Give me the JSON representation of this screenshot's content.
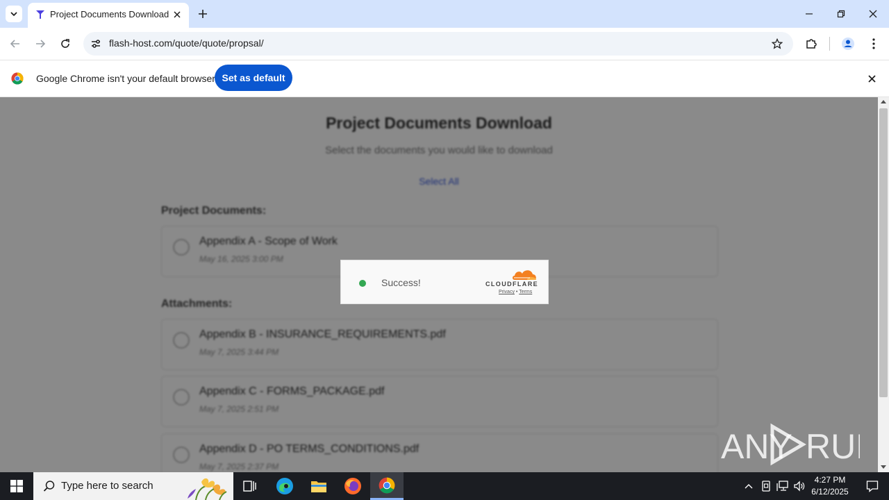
{
  "browser": {
    "tab": {
      "title": "Project Documents Download"
    },
    "url": "flash-host.com/quote/quote/propsal/",
    "infobar": {
      "message": "Google Chrome isn't your default browser",
      "button_label": "Set as default"
    }
  },
  "page": {
    "title": "Project Documents Download",
    "subtitle": "Select the documents you would like to download",
    "select_all": "Select All",
    "sections": {
      "project_documents": {
        "label": "Project Documents:",
        "items": [
          {
            "name": "Appendix A - Scope of Work",
            "date": "May 16, 2025 3:00 PM"
          }
        ]
      },
      "attachments": {
        "label": "Attachments:",
        "items": [
          {
            "name": "Appendix B - INSURANCE_REQUIREMENTS.pdf",
            "date": "May 7, 2025 3:44 PM"
          },
          {
            "name": "Appendix C - FORMS_PACKAGE.pdf",
            "date": "May 7, 2025 2:51 PM"
          },
          {
            "name": "Appendix D - PO TERMS_CONDITIONS.pdf",
            "date": "May 7, 2025 2:37 PM"
          }
        ]
      }
    }
  },
  "cloudflare": {
    "status": "Success!",
    "brand": "CLOUDFLARE",
    "privacy": "Privacy",
    "separator": "•",
    "terms": "Terms"
  },
  "watermark": {
    "text": "ANY RUN"
  },
  "taskbar": {
    "search_placeholder": "Type here to search",
    "time": "4:27 PM",
    "date": "6/12/2025"
  },
  "colors": {
    "accent": "#0b57d0",
    "tabstrip": "#d3e3fd",
    "success": "#34a853",
    "cloudflare_orange": "#f38020"
  }
}
